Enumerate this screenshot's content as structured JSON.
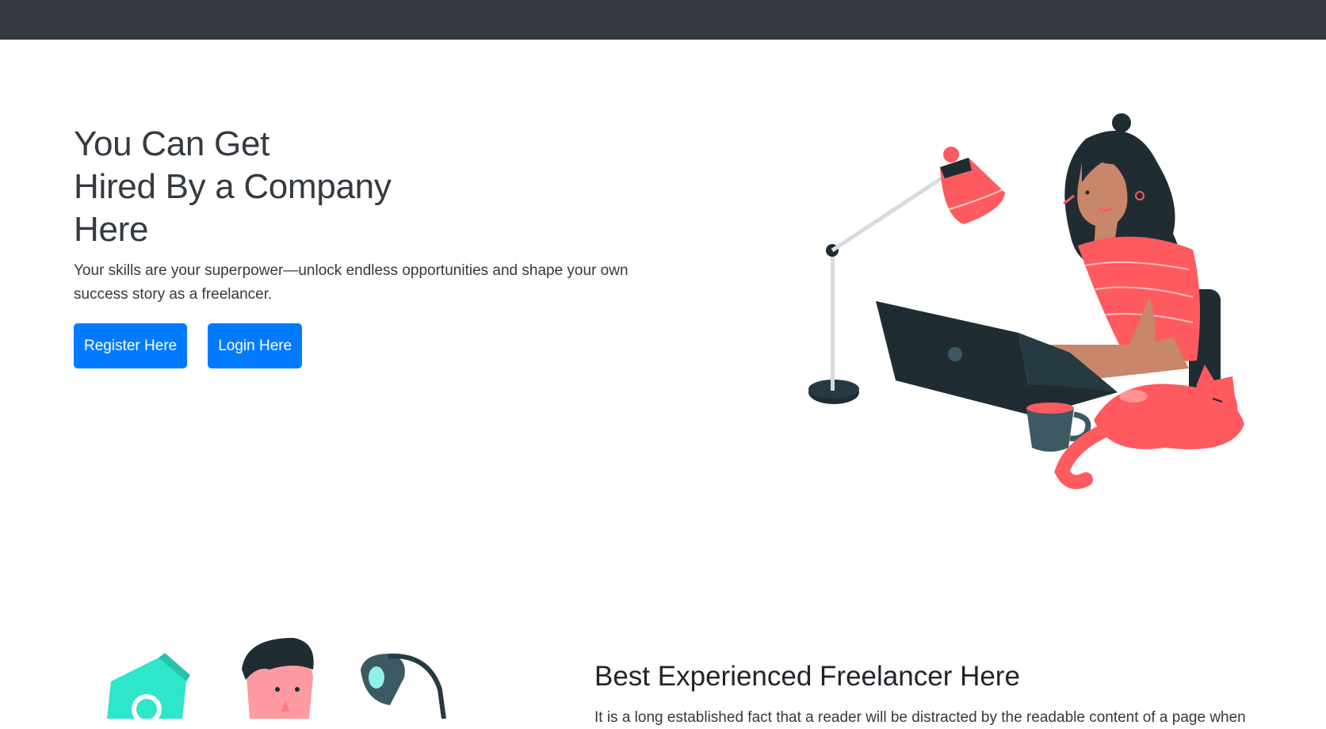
{
  "hero": {
    "title_line1": "You Can Get",
    "title_line2": "Hired By a Company",
    "title_line3": "Here",
    "subtitle": "Your skills are your superpower—unlock endless opportunities and shape your own success story as a freelancer.",
    "register_label": "Register Here",
    "login_label": "Login Here"
  },
  "section": {
    "title": "Best Experienced Freelancer Here",
    "body": "It is a long established fact that a reader will be distracted by the readable content of a page when"
  },
  "colors": {
    "navbar": "#343a40",
    "primary": "#007bff",
    "accent": "#ff5a5f",
    "dark": "#1f2d33",
    "teal": "#2ee6c9"
  },
  "icons": [
    "woman-laptop-illustration",
    "desk-lamp-icon",
    "cat-illustration",
    "gear-icon",
    "person-avatar-icon",
    "lamp-icon"
  ]
}
